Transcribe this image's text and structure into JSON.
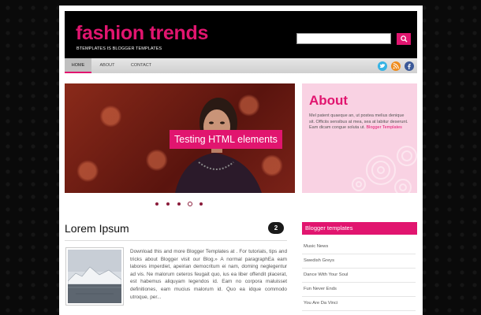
{
  "header": {
    "site_title": "fashion trends",
    "tagline": "BTEMPLATES IS BLOGGER TEMPLATES",
    "search_placeholder": ""
  },
  "nav": {
    "items": [
      {
        "label": "HOME",
        "active": true
      },
      {
        "label": "ABOUT",
        "active": false
      },
      {
        "label": "CONTACT",
        "active": false
      }
    ],
    "social_icons": [
      "twitter-icon",
      "rss-icon",
      "facebook-icon"
    ]
  },
  "slider": {
    "caption": "Testing HTML elements",
    "dots_count": 5,
    "active_dot": 4
  },
  "about": {
    "title": "About",
    "text": "Mel patent quaeque an, ut postea melius denique sit. Officiis sensibus at mea, sea at labitur deserunt. Eam dicam congue soluta ut.",
    "link_label": "Blogger Templates"
  },
  "post": {
    "title": "Lorem Ipsum",
    "comment_count": "2",
    "excerpt": "Download this and more Blogger Templates at . For tutorials, tips and tricks about Blogger visit our Blog.» A normal paragraphEa eam labores imperdiet, apeirian democritum ei nam, doming neglegentur ad vis. Ne malorum ceteros feugait quo, ius ea liber offendit placerat, est habemus aliquyam legendos id. Eam no corpora maluisset definitiones, eam mucius malorum id. Quo ea idque commodo utroque, per..."
  },
  "sidebar": {
    "header": "Blogger templates",
    "links": [
      "Music News",
      "Swedish Greys",
      "Dance With Your Soul",
      "Fun Never Ends",
      "You Are Da Vinci"
    ]
  },
  "colors": {
    "accent": "#e1156f",
    "about_bg": "#f9d2e3",
    "header_bg": "#000000"
  }
}
